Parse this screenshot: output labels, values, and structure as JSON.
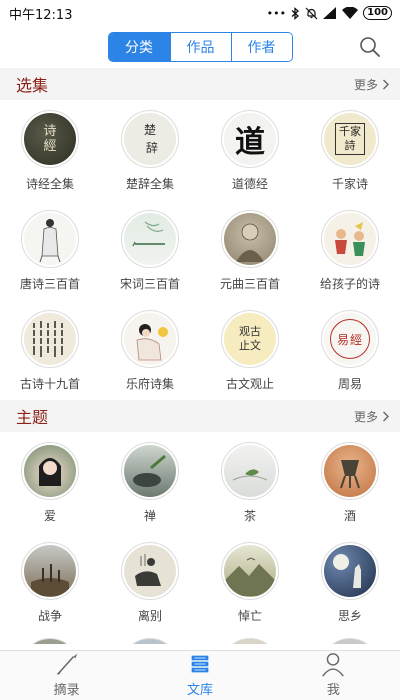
{
  "status_bar": {
    "time": "中午12:13",
    "icons": [
      "dots-icon",
      "bluetooth-icon",
      "mute-icon",
      "signal-icon",
      "wifi-icon"
    ],
    "battery": "100"
  },
  "top_tabs": [
    {
      "label": "分类",
      "active": true
    },
    {
      "label": "作品",
      "active": false
    },
    {
      "label": "作者",
      "active": false
    }
  ],
  "search_icon": "search-icon",
  "sections": {
    "anthology": {
      "title": "选集",
      "more": "更多",
      "items": [
        {
          "label": "诗经全集",
          "art": "诗\n经"
        },
        {
          "label": "楚辞全集",
          "art": "楚\n辞"
        },
        {
          "label": "道德经",
          "art": "道"
        },
        {
          "label": "千家诗",
          "art": "千\n家诗"
        },
        {
          "label": "唐诗三百首",
          "art": ""
        },
        {
          "label": "宋词三百首",
          "art": ""
        },
        {
          "label": "元曲三百首",
          "art": ""
        },
        {
          "label": "给孩子的诗",
          "art": ""
        },
        {
          "label": "古诗十九首",
          "art": ""
        },
        {
          "label": "乐府诗集",
          "art": ""
        },
        {
          "label": "古文观止",
          "art": "观古\n止文"
        },
        {
          "label": "周易",
          "art": "易 經"
        }
      ]
    },
    "theme": {
      "title": "主题",
      "more": "更多",
      "items": [
        {
          "label": "爱"
        },
        {
          "label": "禅"
        },
        {
          "label": "茶"
        },
        {
          "label": "酒"
        },
        {
          "label": "战争"
        },
        {
          "label": "离别"
        },
        {
          "label": "悼亡"
        },
        {
          "label": "思乡"
        }
      ]
    }
  },
  "bottom_tabs": [
    {
      "label": "摘录",
      "icon": "brush-icon",
      "active": false
    },
    {
      "label": "文库",
      "icon": "books-icon",
      "active": true
    },
    {
      "label": "我",
      "icon": "user-icon",
      "active": false
    }
  ],
  "colors": {
    "accent": "#2b84e6",
    "section_title": "#8b2219",
    "section_bg": "#f4f4f4"
  }
}
